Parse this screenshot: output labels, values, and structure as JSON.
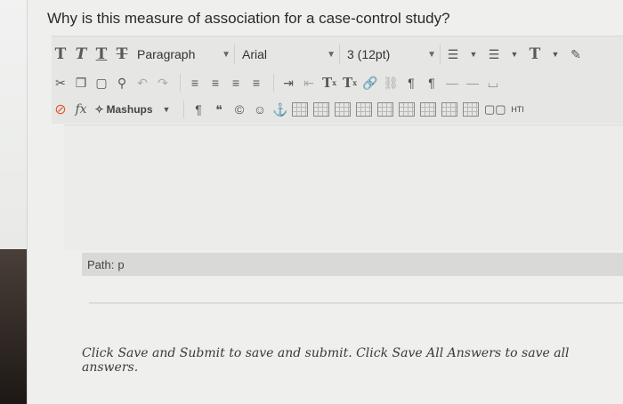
{
  "question": "Why is this measure of association for a case-control study?",
  "toolbar": {
    "row1": {
      "format_buttons": [
        "T",
        "T",
        "T",
        "T"
      ],
      "block_format": "Paragraph",
      "font_family": "Arial",
      "font_size": "3 (12pt)",
      "text_color_label": "T"
    },
    "row2": {
      "superscript": "T",
      "subscript": "T"
    },
    "row3": {
      "mashups_label": "Mashups",
      "fx_label": "fx",
      "html_label": "HTI"
    }
  },
  "path": {
    "label": "Path:",
    "value": "p"
  },
  "footer": {
    "text": "Click Save and Submit to save and submit. Click Save All Answers to save all answers."
  }
}
